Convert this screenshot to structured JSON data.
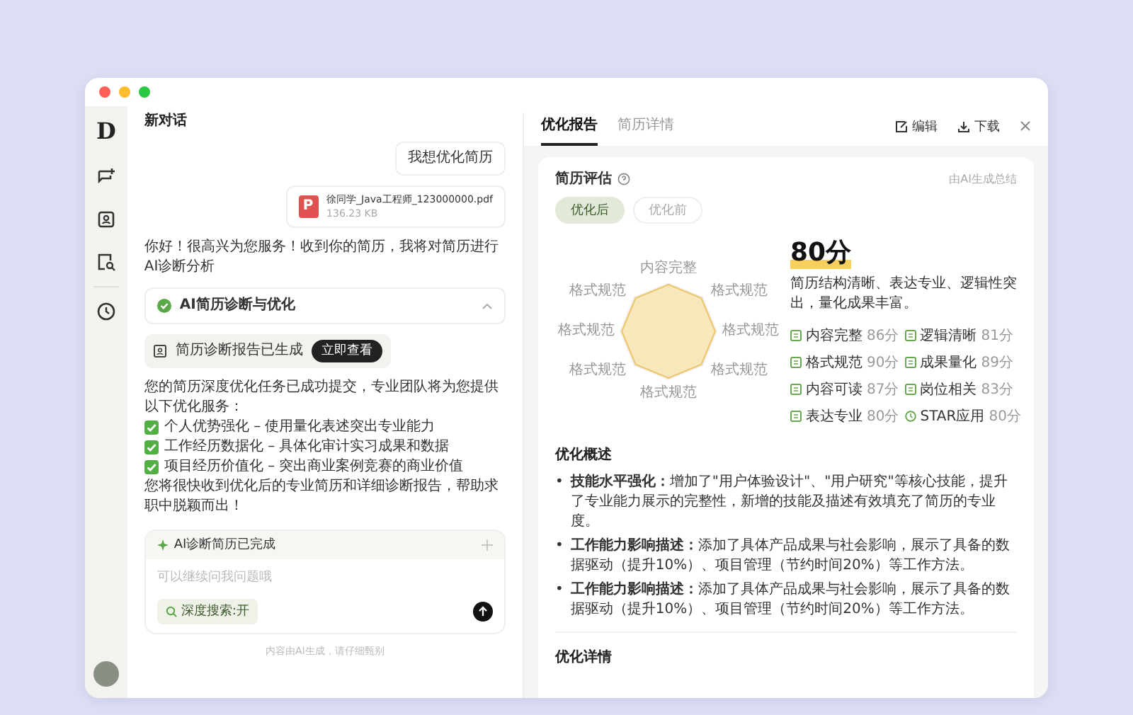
{
  "window": {
    "controls": [
      {
        "color": "#ff5f57"
      },
      {
        "color": "#febc2e"
      },
      {
        "color": "#28c840"
      }
    ]
  },
  "sidebar": {
    "logo": "D",
    "items": [
      {
        "kind": "chat-add"
      },
      {
        "kind": "contact"
      },
      {
        "kind": "doc-search"
      },
      {
        "kind": "history"
      }
    ]
  },
  "chat": {
    "title": "新对话",
    "user_message": "我想优化简历",
    "attachment": {
      "icon_letter": "P",
      "name": "徐同学_Java工程师_123000000.pdf",
      "size": "136.23 KB"
    },
    "greeting": "你好！很高兴为您服务！收到你的简历，我将对简历进行AI诊断分析",
    "diagnosis": {
      "label": "AI简历诊断与优化",
      "done": true,
      "expanded": true
    },
    "report_chip": {
      "label": "简历诊断报告已生成",
      "button": "立即查看"
    },
    "summary": {
      "intro": "您的简历深度优化任务已成功提交，专业团队将为您提供以下优化服务：",
      "items": [
        {
          "text": "个人优势强化 – 使用量化表述突出专业能力",
          "checked": true
        },
        {
          "text": "工作经历数据化 – 具体化审计实习成果和数据",
          "checked": true
        },
        {
          "text": "项目经历价值化 – 突出商业案例竞赛的商业价值",
          "checked": true
        }
      ],
      "closing": "您将很快收到优化后的专业简历和详细诊断报告，帮助求职中脱颖而出！"
    },
    "composer": {
      "status": "AI诊断简历已完成",
      "placeholder": "可以继续问我问题哦",
      "deep_search": {
        "label": "深度搜索:开",
        "on": true
      }
    },
    "disclaimer": "内容由AI生成，请仔细甄别"
  },
  "report": {
    "tabs": [
      {
        "label": "优化报告",
        "selected": true
      },
      {
        "label": "简历详情",
        "selected": false
      }
    ],
    "actions": [
      {
        "kind": "edit",
        "label": "编辑"
      },
      {
        "kind": "download",
        "label": "下载"
      }
    ],
    "assessment": {
      "title": "简历评估",
      "note": "由AI生成总结",
      "toggles": [
        {
          "label": "优化后",
          "selected": true
        },
        {
          "label": "优化前",
          "selected": false
        }
      ],
      "radar_labels": [
        "内容完整",
        "格式规范",
        "格式规范",
        "格式规范",
        "格式规范",
        "格式规范",
        "格式规范",
        "格式规范"
      ],
      "score": "80分",
      "comment": "简历结构清晰、表达专业、逻辑性突出，量化成果丰富。",
      "metrics": [
        {
          "kind": "doc",
          "label": "内容完整",
          "value": "86分"
        },
        {
          "kind": "doc",
          "label": "逻辑清晰",
          "value": "81分"
        },
        {
          "kind": "doc",
          "label": "格式规范",
          "value": "90分"
        },
        {
          "kind": "doc",
          "label": "成果量化",
          "value": "89分"
        },
        {
          "kind": "doc",
          "label": "内容可读",
          "value": "87分"
        },
        {
          "kind": "doc",
          "label": "岗位相关",
          "value": "83分"
        },
        {
          "kind": "doc",
          "label": "表达专业",
          "value": "80分"
        },
        {
          "kind": "clock",
          "label": "STAR应用",
          "value": "80分"
        }
      ]
    },
    "overview": {
      "title": "优化概述",
      "items": [
        {
          "marker": "•",
          "text": "**技能水平强化：**增加了\"用户体验设计\"、\"用户研究\"等核心技能，提升了专业能力展示的完整性，新增的技能及描述有效填充了简历的专业度。"
        },
        {
          "marker": "•",
          "text": "**工作能力影响描述：**添加了具体产品成果与社会影响，展示了具备的数据驱动（提升10%）、项目管理（节约时间20%）等工作方法。"
        },
        {
          "marker": "•",
          "text": "**工作能力影响描述：**添加了具体产品成果与社会影响，展示了具备的数据驱动（提升10%）、项目管理（节约时间20%）等工作方法。"
        }
      ]
    },
    "details": {
      "title": "优化详情"
    }
  }
}
